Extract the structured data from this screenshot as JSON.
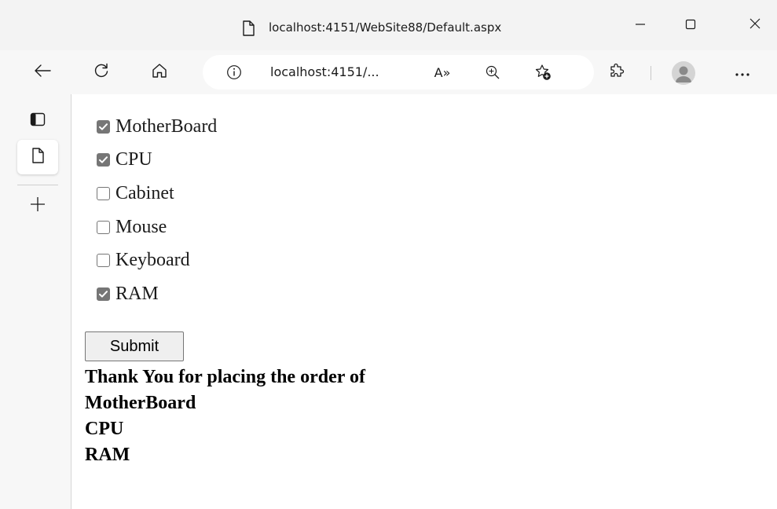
{
  "browser": {
    "title": "localhost:4151/WebSite88/Default.aspx",
    "address_url": "localhost:4151/...",
    "read_aloud_glyph": "A»",
    "icons": {
      "title_page": "page-icon",
      "minimize": "minimize-icon",
      "maximize": "maximize-icon",
      "close": "close-icon",
      "back": "back-arrow-icon",
      "refresh": "refresh-icon",
      "home": "home-icon",
      "site_info": "info-icon",
      "read_aloud": "read-aloud-icon",
      "zoom": "zoom-in-icon",
      "favorites": "add-favorite-icon",
      "extensions": "extensions-icon",
      "profile": "profile-avatar",
      "more": "more-options-icon"
    }
  },
  "sidebar": {
    "items": [
      {
        "icon": "tab-actions-icon"
      },
      {
        "icon": "page-tab-icon",
        "active": true
      },
      {
        "icon": "new-tab-plus-icon"
      }
    ]
  },
  "form": {
    "options": [
      {
        "label": "MotherBoard",
        "checked": true
      },
      {
        "label": "CPU",
        "checked": true
      },
      {
        "label": "Cabinet",
        "checked": false
      },
      {
        "label": "Mouse",
        "checked": false
      },
      {
        "label": "Keyboard",
        "checked": false
      },
      {
        "label": "RAM",
        "checked": true
      }
    ],
    "submit_label": "Submit",
    "result_heading": "Thank You for placing the order of",
    "result_items": [
      "MotherBoard",
      "CPU",
      "RAM"
    ]
  },
  "colors": {
    "titlebar_bg": "#f3f3f3",
    "toolbar_bg": "#f7f7f7",
    "checkbox_checked": "#767676",
    "text": "#000000"
  }
}
